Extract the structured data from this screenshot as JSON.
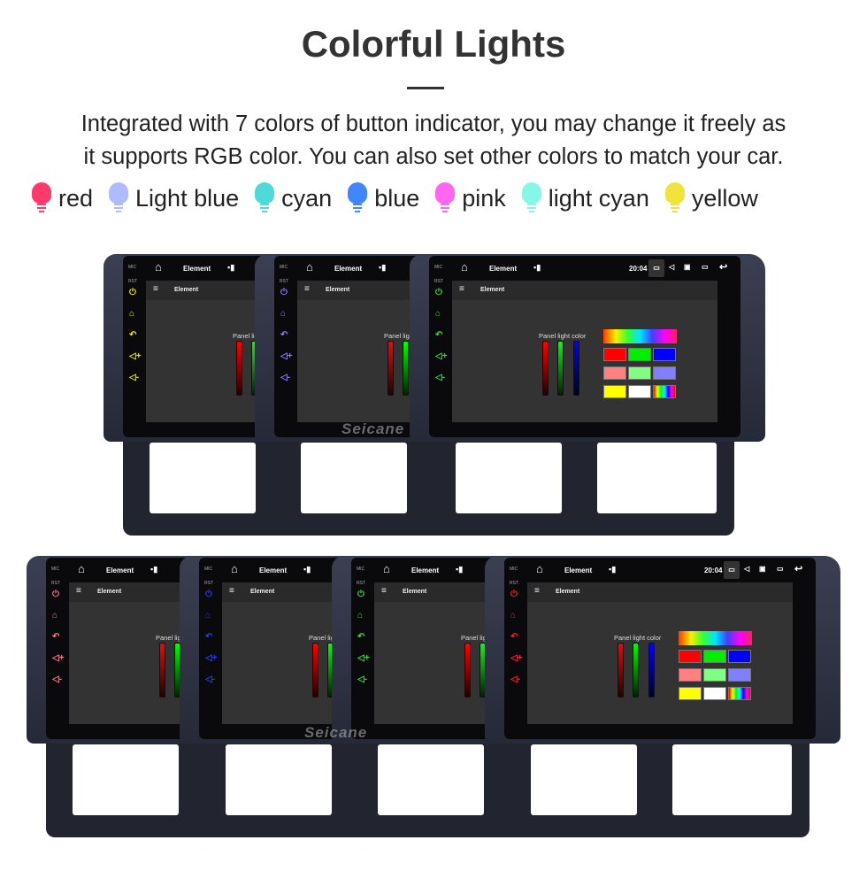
{
  "header": {
    "title": "Colorful Lights",
    "description_line1": "Integrated with 7 colors of button indicator, you may change it freely as",
    "description_line2": "it supports RGB color. You can also set other colors to match your car."
  },
  "legend": [
    {
      "label": "red",
      "color": "#ff3a6a",
      "icon": "bulb-icon"
    },
    {
      "label": "Light blue",
      "color": "#aebcff",
      "icon": "bulb-icon"
    },
    {
      "label": "cyan",
      "color": "#4edad8",
      "icon": "bulb-icon"
    },
    {
      "label": "blue",
      "color": "#3f86ff",
      "icon": "bulb-icon"
    },
    {
      "label": "pink",
      "color": "#ff66f0",
      "icon": "bulb-icon"
    },
    {
      "label": "light cyan",
      "color": "#86f7e6",
      "icon": "bulb-icon"
    },
    {
      "label": "yellow",
      "color": "#f2e23c",
      "icon": "bulb-icon"
    }
  ],
  "screen": {
    "app_title": "Element",
    "page_title": "Element",
    "panel_label": "Panel light color",
    "time": "20:04",
    "mic_label": "MIC",
    "rst_label": "RST"
  },
  "watermark": "Seicane",
  "units": [
    {
      "indicator_color": "#e6e400"
    },
    {
      "indicator_color": "#8a7cff"
    },
    {
      "indicator_color": "#3ad63a"
    },
    {
      "indicator_color": "#ff7a8a"
    },
    {
      "indicator_color": "#2a3aff"
    },
    {
      "indicator_color": "#30e030"
    },
    {
      "indicator_color": "#ff2020"
    }
  ],
  "palette": [
    "#ff0000",
    "#00ee00",
    "#0000ff",
    "#ff8080",
    "#80ff80",
    "#8080ff",
    "#ffff00",
    "#ffffff",
    "rainbow"
  ]
}
